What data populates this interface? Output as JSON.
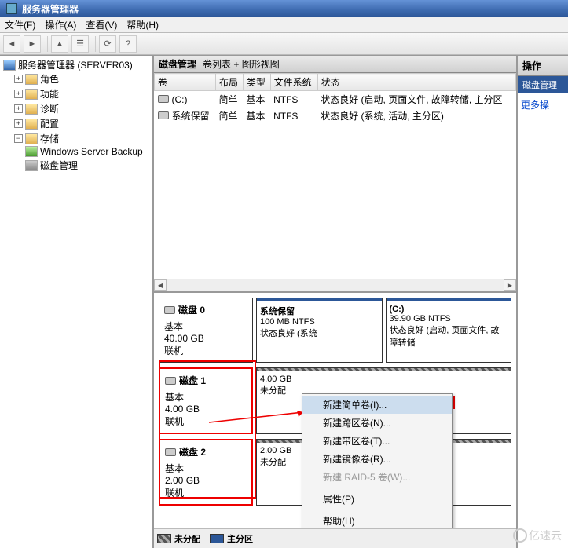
{
  "title": "服务器管理器",
  "menus": {
    "file": "文件(F)",
    "action": "操作(A)",
    "view": "查看(V)",
    "help": "帮助(H)"
  },
  "toolbar": {
    "back": "◄",
    "fwd": "►",
    "up": "▲",
    "props": "☰",
    "refresh": "⟳",
    "help": "?"
  },
  "tree": {
    "root": "服务器管理器 (SERVER03)",
    "roles": "角色",
    "features": "功能",
    "diagnostics": "诊断",
    "config": "配置",
    "storage": "存储",
    "wsb": "Windows Server Backup",
    "diskmgmt": "磁盘管理"
  },
  "center": {
    "title": "磁盘管理",
    "subtitle": "卷列表 + 图形视图",
    "cols": {
      "vol": "卷",
      "layout": "布局",
      "type": "类型",
      "fs": "文件系统",
      "status": "状态"
    },
    "rows": [
      {
        "vol": "(C:)",
        "layout": "简单",
        "type": "基本",
        "fs": "NTFS",
        "status": "状态良好 (启动, 页面文件, 故障转储, 主分区"
      },
      {
        "vol": "系统保留",
        "layout": "简单",
        "type": "基本",
        "fs": "NTFS",
        "status": "状态良好 (系统, 活动, 主分区)"
      }
    ]
  },
  "disks": [
    {
      "name": "磁盘 0",
      "kind": "基本",
      "size": "40.00 GB",
      "state": "联机",
      "parts": [
        {
          "title": "系统保留",
          "line2": "100 MB NTFS",
          "line3": "状态良好 (系统"
        },
        {
          "title": "(C:)",
          "line2": "39.90 GB NTFS",
          "line3": "状态良好 (启动, 页面文件, 故障转储"
        }
      ]
    },
    {
      "name": "磁盘 1",
      "kind": "基本",
      "size": "4.00 GB",
      "state": "联机",
      "parts": [
        {
          "title": "",
          "line2": "4.00 GB",
          "line3": "未分配",
          "hatch": true
        }
      ]
    },
    {
      "name": "磁盘 2",
      "kind": "基本",
      "size": "2.00 GB",
      "state": "联机",
      "parts": [
        {
          "title": "",
          "line2": "2.00 GB",
          "line3": "未分配",
          "hatch": true
        }
      ]
    }
  ],
  "legend": {
    "unalloc": "未分配",
    "primary": "主分区"
  },
  "ctx": {
    "simple": "新建简单卷(I)...",
    "span": "新建跨区卷(N)...",
    "stripe": "新建带区卷(T)...",
    "mirror": "新建镜像卷(R)...",
    "raid5": "新建 RAID-5 卷(W)...",
    "props": "属性(P)",
    "help": "帮助(H)"
  },
  "actions": {
    "header": "操作",
    "sub": "磁盘管理",
    "more": "更多操"
  },
  "watermark": "亿速云"
}
